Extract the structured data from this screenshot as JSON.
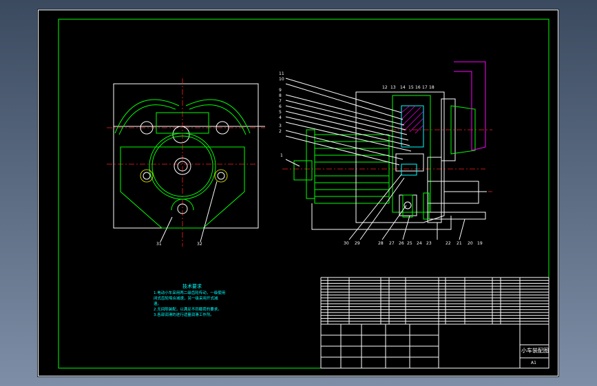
{
  "drawing": {
    "title": "小车装配图",
    "sheet_size": "A1",
    "technical_requirements": {
      "heading": "技术要求",
      "items": [
        "1.电动小车采用两二级齿轮传动，一级使用",
        "  闭式齿轮啮合减速，另一级采用开式减",
        "  速。",
        "2.无间隙装配，以满足不同载荷的要求。",
        "3.各部润滑的进行适量润滑工作剂。"
      ]
    },
    "front_view_labels": [
      "31",
      "32"
    ],
    "side_view_top_labels": [
      "12",
      "13",
      "14",
      "15",
      "16",
      "17",
      "18"
    ],
    "side_view_left_labels": [
      "11",
      "10",
      "9",
      "8",
      "7",
      "6",
      "5",
      "4",
      "3",
      "2",
      "1"
    ],
    "side_view_bottom_labels": [
      "30",
      "29",
      "28",
      "27",
      "26",
      "25",
      "24",
      "23",
      "22",
      "21",
      "20",
      "19"
    ]
  },
  "colors": {
    "background": "#000000",
    "outline": "#ffffff",
    "part": "#00ff00",
    "center_line": "#ff2020",
    "section": "#00ffff",
    "hatch": "#ff00ff"
  }
}
